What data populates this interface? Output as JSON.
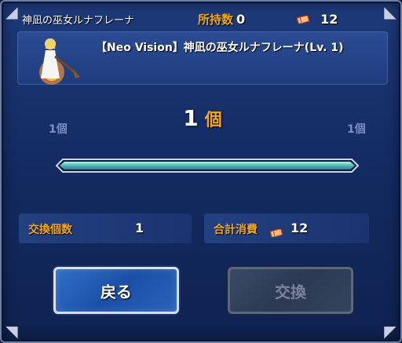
{
  "header": {
    "title": "神凪の巫女ルナフレーナ",
    "owned_label": "所持数",
    "owned_value": "0",
    "ticket_count": "12"
  },
  "item": {
    "name": "【Neo Vision】神凪の巫女ルナフレーナ(Lv. 1)"
  },
  "quantity": {
    "current": "1",
    "unit": "個",
    "min_label": "1個",
    "max_label": "1個",
    "slider_fraction": 1.0
  },
  "summary": {
    "exchange_count_label": "交換個数",
    "exchange_count_value": "1",
    "total_cost_label": "合計消費",
    "total_cost_value": "12"
  },
  "buttons": {
    "back_label": "戻る",
    "exchange_label": "交換"
  },
  "colors": {
    "accent_orange": "#f4a820",
    "panel_blue": "#1f3c7e",
    "disabled_gray": "#7a8498"
  },
  "icons": {
    "ticket": "ticket-icon",
    "corner": "corner-ornament-icon"
  }
}
